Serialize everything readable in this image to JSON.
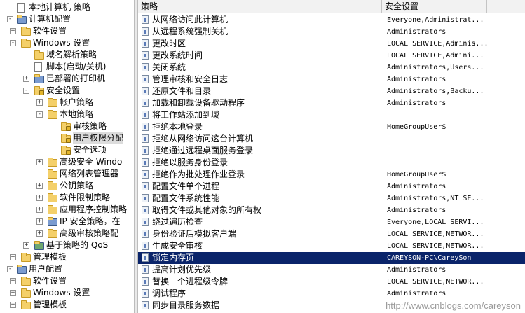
{
  "tree": [
    {
      "label": "本地计算机 策略",
      "level": 0,
      "expander": "",
      "icon": "doc-icon"
    },
    {
      "label": "计算机配置",
      "level": 0,
      "expander": "-",
      "icon": "computer-icon"
    },
    {
      "label": "软件设置",
      "level": 1,
      "expander": "+",
      "icon": "folder-icon"
    },
    {
      "label": "Windows 设置",
      "level": 1,
      "expander": "-",
      "icon": "folder-icon"
    },
    {
      "label": "域名解析策略",
      "level": 2,
      "expander": "",
      "icon": "folder-icon"
    },
    {
      "label": "脚本(启动/关机)",
      "level": 2,
      "expander": "",
      "icon": "script-icon"
    },
    {
      "label": "已部署的打印机",
      "level": 2,
      "expander": "+",
      "icon": "printer-icon"
    },
    {
      "label": "安全设置",
      "level": 2,
      "expander": "-",
      "icon": "lock-folder-icon"
    },
    {
      "label": "帐户策略",
      "level": 3,
      "expander": "+",
      "icon": "folder-icon"
    },
    {
      "label": "本地策略",
      "level": 3,
      "expander": "-",
      "icon": "folder-icon"
    },
    {
      "label": "审核策略",
      "level": 4,
      "expander": "",
      "icon": "lock-folder-icon"
    },
    {
      "label": "用户权限分配",
      "level": 4,
      "expander": "",
      "icon": "lock-folder-icon",
      "selected": true
    },
    {
      "label": "安全选项",
      "level": 4,
      "expander": "",
      "icon": "lock-folder-icon"
    },
    {
      "label": "高级安全 Windo",
      "level": 3,
      "expander": "+",
      "icon": "folder-icon"
    },
    {
      "label": "网络列表管理器",
      "level": 3,
      "expander": "",
      "icon": "folder-icon"
    },
    {
      "label": "公钥策略",
      "level": 3,
      "expander": "+",
      "icon": "folder-icon"
    },
    {
      "label": "软件限制策略",
      "level": 3,
      "expander": "+",
      "icon": "folder-icon"
    },
    {
      "label": "应用程序控制策略",
      "level": 3,
      "expander": "+",
      "icon": "folder-icon"
    },
    {
      "label": "IP 安全策略，在",
      "level": 3,
      "expander": "+",
      "icon": "shield-icon"
    },
    {
      "label": "高级审核策略配",
      "level": 3,
      "expander": "+",
      "icon": "folder-icon"
    },
    {
      "label": "基于策略的 QoS",
      "level": 2,
      "expander": "+",
      "icon": "chart-icon"
    },
    {
      "label": "管理模板",
      "level": 1,
      "expander": "+",
      "icon": "folder-icon"
    },
    {
      "label": "用户配置",
      "level": 0,
      "expander": "-",
      "icon": "user-icon"
    },
    {
      "label": "软件设置",
      "level": 1,
      "expander": "+",
      "icon": "folder-icon"
    },
    {
      "label": "Windows 设置",
      "level": 1,
      "expander": "+",
      "icon": "folder-icon"
    },
    {
      "label": "管理模板",
      "level": 1,
      "expander": "+",
      "icon": "folder-icon"
    }
  ],
  "columns": {
    "policy": "策略",
    "security": "安全设置"
  },
  "rows": [
    {
      "policy": "从网络访问此计算机",
      "value": "Everyone,Administrat..."
    },
    {
      "policy": "从远程系统强制关机",
      "value": "Administrators"
    },
    {
      "policy": "更改时区",
      "value": "LOCAL SERVICE,Adminis..."
    },
    {
      "policy": "更改系统时间",
      "value": "LOCAL SERVICE,Admini..."
    },
    {
      "policy": "关闭系统",
      "value": "Administrators,Users..."
    },
    {
      "policy": "管理审核和安全日志",
      "value": "Administrators"
    },
    {
      "policy": "还原文件和目录",
      "value": "Administrators,Backu..."
    },
    {
      "policy": "加载和卸载设备驱动程序",
      "value": "Administrators"
    },
    {
      "policy": "将工作站添加到域",
      "value": ""
    },
    {
      "policy": "拒绝本地登录",
      "value": "HomeGroupUser$"
    },
    {
      "policy": "拒绝从网络访问这台计算机",
      "value": ""
    },
    {
      "policy": "拒绝通过远程桌面服务登录",
      "value": ""
    },
    {
      "policy": "拒绝以服务身份登录",
      "value": ""
    },
    {
      "policy": "拒绝作为批处理作业登录",
      "value": "HomeGroupUser$"
    },
    {
      "policy": "配置文件单个进程",
      "value": "Administrators"
    },
    {
      "policy": "配置文件系统性能",
      "value": "Administrators,NT SE..."
    },
    {
      "policy": "取得文件或其他对象的所有权",
      "value": "Administrators"
    },
    {
      "policy": "绕过遍历检查",
      "value": "Everyone,LOCAL SERVI..."
    },
    {
      "policy": "身份验证后模拟客户端",
      "value": "LOCAL SERVICE,NETWOR..."
    },
    {
      "policy": "生成安全审核",
      "value": "LOCAL SERVICE,NETWOR..."
    },
    {
      "policy": "锁定内存页",
      "value": "CAREYSON-PC\\CareySon",
      "selected": true
    },
    {
      "policy": "提高计划优先级",
      "value": "Administrators"
    },
    {
      "policy": "替换一个进程级令牌",
      "value": "LOCAL SERVICE,NETWOR..."
    },
    {
      "policy": "调试程序",
      "value": "Administrators"
    },
    {
      "policy": "同步目录服务数据",
      "value": ""
    }
  ],
  "watermark": "http://www.cnblogs.com/careyson",
  "colors": {
    "selection": "#0a246a",
    "folder": "#f4d06a"
  }
}
